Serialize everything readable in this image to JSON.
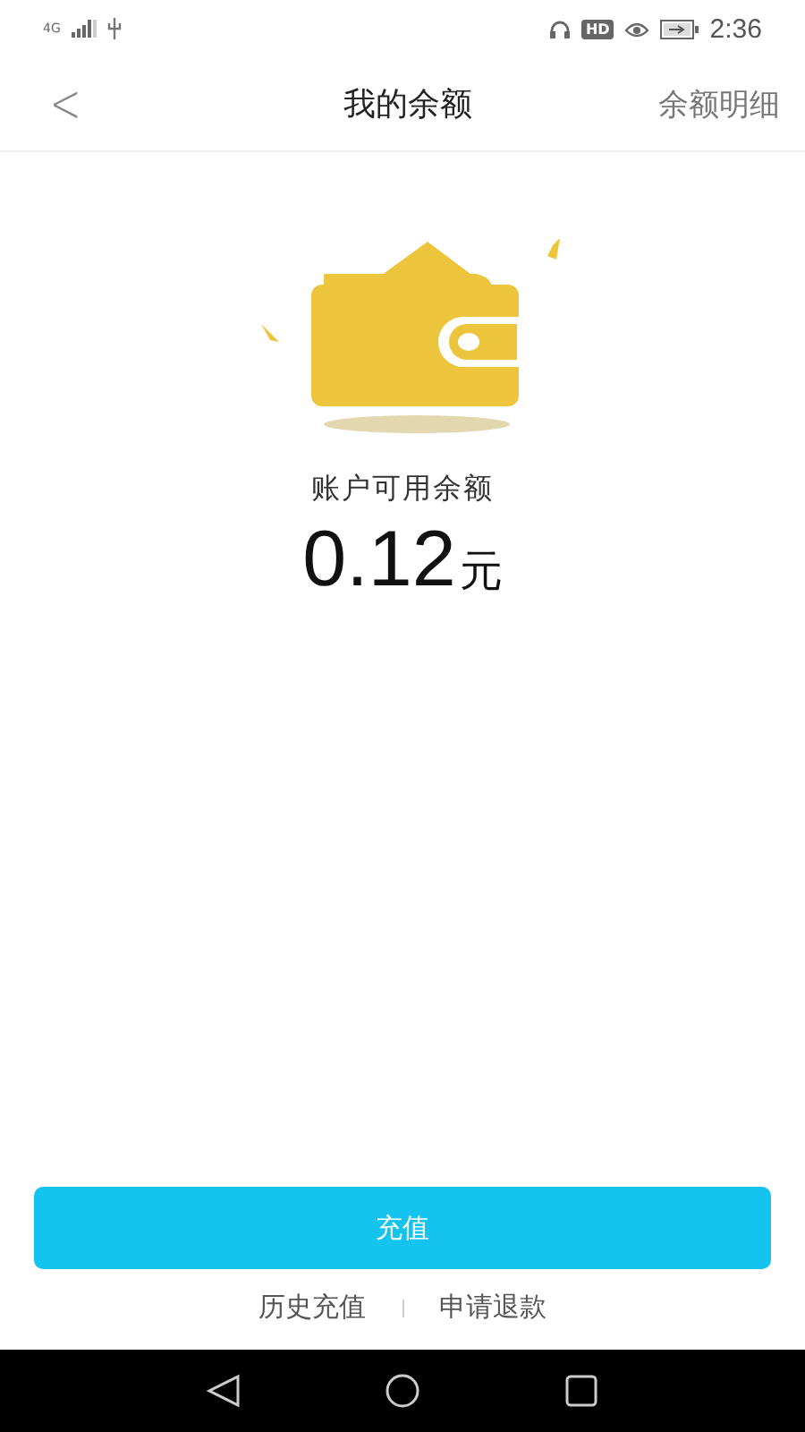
{
  "status_bar": {
    "network": "4G",
    "hd_badge": "HD",
    "time": "2:36"
  },
  "header": {
    "back": "<",
    "title": "我的余额",
    "action": "余额明细"
  },
  "balance": {
    "label": "账户可用余额",
    "amount": "0.12",
    "unit": "元"
  },
  "recharge_button": "充值",
  "links": [
    {
      "label": "历史充值"
    },
    {
      "label": "申请退款"
    }
  ]
}
